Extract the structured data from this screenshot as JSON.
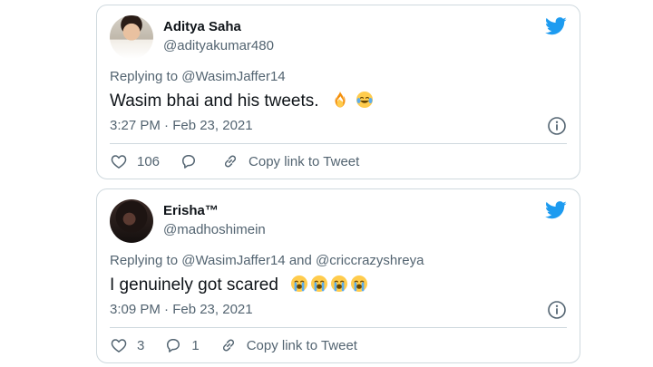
{
  "brand": {
    "twitter_blue": "#1d9bf0",
    "text_primary": "#0f1419",
    "text_secondary": "#536471",
    "border": "#cfd9de"
  },
  "tweets": [
    {
      "display_name": "Aditya Saha",
      "handle": "@adityakumar480",
      "replying_prefix": "Replying to ",
      "replying_to": [
        "@WasimJaffer14"
      ],
      "replying_join": "",
      "text": "Wasim bhai and his tweets.",
      "emojis": [
        "fire-emoji",
        "joy-emoji"
      ],
      "timestamp": "3:27 PM · Feb 23, 2021",
      "likes": "106",
      "replies": "",
      "copy_link_label": "Copy link to Tweet",
      "icons": [
        "twitter-bird-icon",
        "info-icon",
        "heart-icon",
        "reply-icon",
        "link-icon"
      ]
    },
    {
      "display_name": "Erisha™",
      "handle": "@madhoshimein",
      "replying_prefix": "Replying to ",
      "replying_to": [
        "@WasimJaffer14",
        "@criccrazyshreya"
      ],
      "replying_join": " and ",
      "text": "I genuinely got scared",
      "emojis": [
        "loudly-crying-emoji",
        "loudly-crying-emoji",
        "loudly-crying-emoji",
        "loudly-crying-emoji"
      ],
      "timestamp": "3:09 PM · Feb 23, 2021",
      "likes": "3",
      "replies": "1",
      "copy_link_label": "Copy link to Tweet",
      "icons": [
        "twitter-bird-icon",
        "info-icon",
        "heart-icon",
        "reply-icon",
        "link-icon"
      ]
    }
  ]
}
